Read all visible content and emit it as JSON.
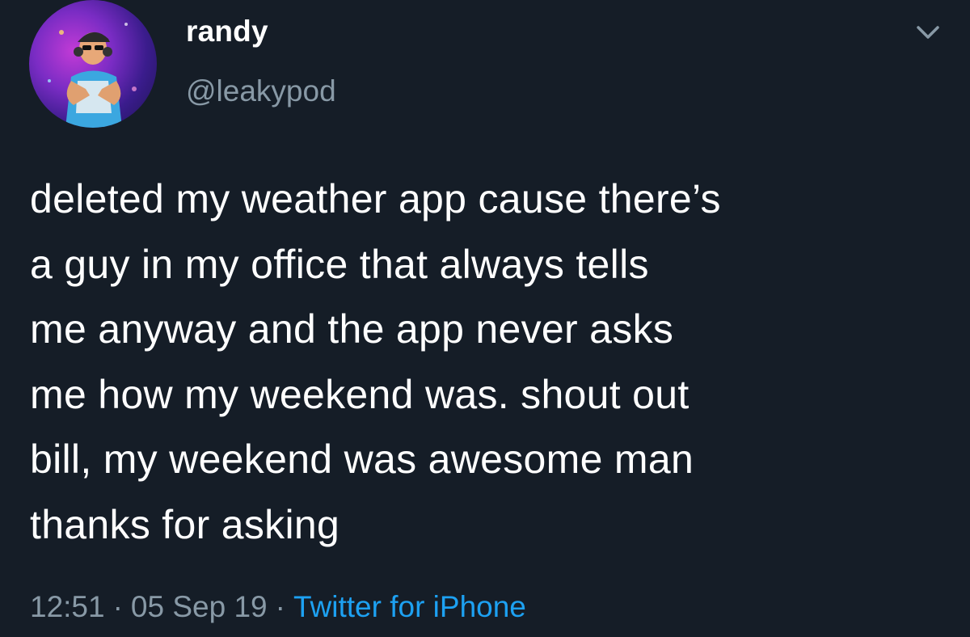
{
  "author": {
    "display_name": "randy",
    "handle": "@leakypod",
    "avatar_icon": "profile-avatar"
  },
  "menu": {
    "icon": "chevron-down-icon"
  },
  "tweet": {
    "lines": [
      "deleted my weather app cause there’s",
      "a guy in my office that always tells",
      "me anyway and the app never asks",
      "me how my weekend was. shout out",
      "bill, my weekend was awesome man",
      "thanks for asking"
    ]
  },
  "meta": {
    "time": "12:51",
    "date": "05 Sep 19",
    "separator": "·",
    "source": "Twitter for iPhone"
  },
  "colors": {
    "background": "#151d27",
    "text": "#ffffff",
    "secondary": "#8899a6",
    "link": "#1da1f2"
  }
}
